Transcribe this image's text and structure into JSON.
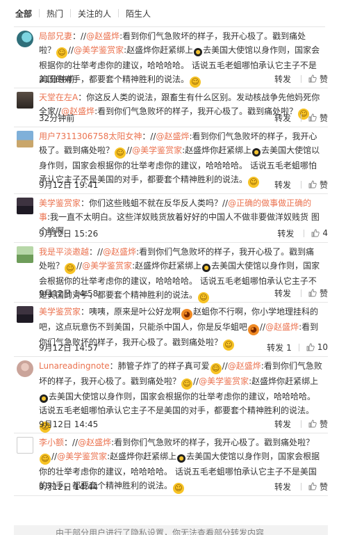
{
  "tabs": [
    {
      "label": "全部",
      "active": true
    },
    {
      "label": "热门",
      "active": false
    },
    {
      "label": "关注的人",
      "active": false
    },
    {
      "label": "陌生人",
      "active": false
    }
  ],
  "actions": {
    "forward": "转发",
    "like": "赞"
  },
  "comments": [
    {
      "user": "局部兄妻",
      "segments": [
        {
          "t": "：//"
        },
        {
          "u": "@赵盛烨"
        },
        {
          "t": ":看到你们气急败坏的样子，我开心极了。戳到痛处啦？"
        },
        {
          "e": "yellow"
        },
        {
          "t": "//"
        },
        {
          "u": "@美学鉴赏家"
        },
        {
          "t": ":赵盛烨你赶紧绑上"
        },
        {
          "e": "bomb"
        },
        {
          "t": "去美国大使馆以身作则，国家会根据你的壮举考虑你的建议，哈哈哈哈。    话说五毛老蛆哪怕承认它主子不是美国的对手，都要套个精神胜利的说法。"
        },
        {
          "e": "yellow"
        }
      ],
      "time": "21分钟前",
      "forward": "",
      "likes": ""
    },
    {
      "user": "天堂在左A",
      "segments": [
        {
          "t": "：你这反人类的说法，跟畜生有什么区别。发动核战争先他妈死你全家//"
        },
        {
          "u": "@赵盛烨"
        },
        {
          "t": ":看到你们气急败坏的样子，我开心极了。戳到痛处啦？"
        },
        {
          "e": "yellow"
        }
      ],
      "time": "32分钟前",
      "forward": "",
      "likes": ""
    },
    {
      "user": "用户7311306758太阳女神",
      "segments": [
        {
          "t": "：//"
        },
        {
          "u": "@赵盛烨"
        },
        {
          "t": ":看到你们气急败坏的样子，我开心极了。戳到痛处啦？"
        },
        {
          "e": "yellow"
        },
        {
          "t": "//"
        },
        {
          "u": "@美学鉴赏家"
        },
        {
          "t": ":赵盛烨你赶紧绑上"
        },
        {
          "e": "bomb"
        },
        {
          "t": "去美国大使馆以身作则，国家会根据你的壮举考虑你的建议，哈哈哈哈。   话说五毛老蛆哪怕承认它主子不是美国的对手，都要套个精神胜利的说法。"
        },
        {
          "e": "yellow"
        }
      ],
      "time": "9月12日 19:41",
      "forward": "",
      "likes": ""
    },
    {
      "user": "美学鉴赏家",
      "segments": [
        {
          "t": "：你们这些贱蛆不就在反华反人类吗？//"
        },
        {
          "u": "@正确的做事做正确的事"
        },
        {
          "t": ":我一直不太明白。这些洋奴贱货放着好好的中国人不做非要做洋奴贱货 图个啥啊"
        }
      ],
      "time": "9月12日 15:26",
      "forward": "",
      "likes": "4"
    },
    {
      "user": "我是平淡邀越",
      "segments": [
        {
          "t": "：//"
        },
        {
          "u": "@赵盛烨"
        },
        {
          "t": ":看到你们气急败坏的样子，我开心极了。戳到痛处啦？"
        },
        {
          "e": "yellow"
        },
        {
          "t": "//"
        },
        {
          "u": "@美学鉴赏家"
        },
        {
          "t": ":赵盛烨你赶紧绑上"
        },
        {
          "e": "bomb"
        },
        {
          "t": "去美国大使馆以身作则，国家会根据你的壮举考虑你的建议，哈哈哈哈。    话说五毛老蛆哪怕承认它主子不是美国的对手，都要套个精神胜利的说法。"
        },
        {
          "e": "yellow"
        }
      ],
      "time": "9月12日 14:58",
      "forward": "",
      "likes": ""
    },
    {
      "user": "美学鉴赏家",
      "segments": [
        {
          "t": "：咦咦，原来是叶公好龙啊"
        },
        {
          "e": "angry"
        },
        {
          "t": "赵蛆你不行啊，你小学地理挂科的吧，这点玩意伤不到美国，只能杀中国人，你是反华蛆吧"
        },
        {
          "e": "angry"
        },
        {
          "t": "//"
        },
        {
          "u": "@赵盛烨"
        },
        {
          "t": ":看到你们气急败坏的样子，我开心极了。戳到痛处啦？"
        },
        {
          "e": "yellow"
        }
      ],
      "time": "9月12日 14:57",
      "forward": "1",
      "likes": "10"
    },
    {
      "user": "Lunareadingnote",
      "segments": [
        {
          "t": "：肺管子炸了的样子真可爱"
        },
        {
          "e": "yellow"
        },
        {
          "t": "//"
        },
        {
          "u": "@赵盛烨"
        },
        {
          "t": ":看到你们气急败坏的样子，我开心极了。戳到痛处啦？"
        },
        {
          "e": "yellow"
        },
        {
          "t": "//"
        },
        {
          "u": "@美学鉴赏家"
        },
        {
          "t": ":赵盛烨你赶紧绑上"
        },
        {
          "e": "bomb"
        },
        {
          "t": "去美国大使馆以身作则，国家会根据你的壮举考虑你的建议，哈哈哈哈。   话说五毛老蛆哪怕承认它主子不是美国的对手，都要套个精神胜利的说法。"
        },
        {
          "e": "yellow"
        }
      ],
      "time": "9月12日 14:45",
      "forward": "",
      "likes": ""
    },
    {
      "user": "李小额",
      "segments": [
        {
          "t": "：//"
        },
        {
          "u": "@赵盛烨"
        },
        {
          "t": ":看到你们气急败坏的样子，我开心极了。戳到痛处啦？"
        },
        {
          "e": "yellow"
        },
        {
          "t": "//"
        },
        {
          "u": "@美学鉴赏家"
        },
        {
          "t": ":赵盛烨你赶紧绑上"
        },
        {
          "e": "bomb"
        },
        {
          "t": "去美国大使馆以身作则，国家会根据你的壮举考虑你的建议，哈哈哈哈。   话说五毛老蛆哪怕承认它主子不是美国的对手，都要套个精神胜利的说法。"
        },
        {
          "e": "yellow"
        }
      ],
      "time": "9月12日 14:44",
      "forward": "",
      "likes": ""
    }
  ],
  "notice": "由于部分用户进行了隐私设置，你无法查看部分转发内容"
}
